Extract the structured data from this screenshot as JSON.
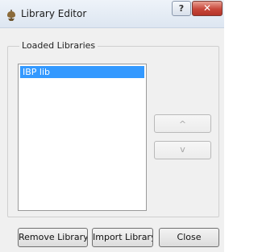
{
  "window": {
    "title": "Library Editor",
    "help_label": "?",
    "close_label": "✕",
    "icon": "library-app-icon"
  },
  "group": {
    "legend": "Loaded Libraries"
  },
  "libraries": {
    "items": [
      {
        "label": "IBP lib",
        "selected": true
      }
    ]
  },
  "side_buttons": {
    "up_label": "^",
    "down_label": "v",
    "enabled": false
  },
  "buttons": {
    "remove_label": "Remove Library",
    "import_label": "Import Library",
    "close_label": "Close"
  },
  "colors": {
    "selection": "#3399ff",
    "window_bg": "#f0f0f0",
    "close_btn": "#c8473a"
  }
}
